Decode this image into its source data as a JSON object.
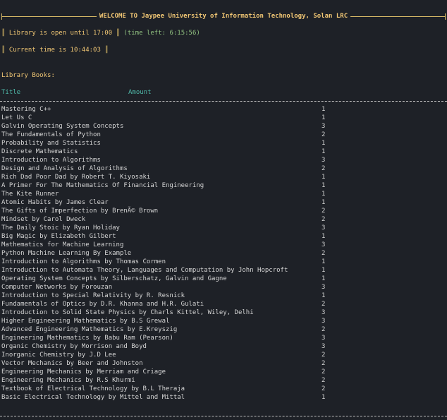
{
  "banner": {
    "title": "WELCOME TO Jaypee University of Information Technology, Solan LRC"
  },
  "status": {
    "open_text": "Library is open until 17:00",
    "time_left": "(time left: 6:15:56)",
    "current_time": "Current time is 10:44:03"
  },
  "books": {
    "section_label": "Library Books:",
    "columns": {
      "title": "Title",
      "amount": "Amount"
    },
    "rows": [
      {
        "title": "Mastering C++",
        "amount": "1"
      },
      {
        "title": "Let Us C",
        "amount": "1"
      },
      {
        "title": "Galvin Operating System Concepts",
        "amount": "3"
      },
      {
        "title": "The Fundamentals of Python",
        "amount": "2"
      },
      {
        "title": "Probability and Statistics",
        "amount": "1"
      },
      {
        "title": "Discrete Mathematics",
        "amount": "1"
      },
      {
        "title": "Introduction to Algorithms",
        "amount": "3"
      },
      {
        "title": "Design and Analysis of Algorithms",
        "amount": "2"
      },
      {
        "title": "Rich Dad Poor Dad by Robert T. Kiyosaki",
        "amount": "1"
      },
      {
        "title": "A Primer For The Mathematics Of Financial Engineering",
        "amount": "1"
      },
      {
        "title": "The Kite Runner",
        "amount": "1"
      },
      {
        "title": "Atomic Habits by James Clear",
        "amount": "1"
      },
      {
        "title": "The Gifts of Imperfection by BrenÃ© Brown",
        "amount": "2"
      },
      {
        "title": "Mindset by Carol Dweck",
        "amount": "2"
      },
      {
        "title": "The Daily Stoic by Ryan Holiday",
        "amount": "3"
      },
      {
        "title": "Big Magic by Elizabeth Gilbert",
        "amount": "1"
      },
      {
        "title": "Mathematics for Machine Learning",
        "amount": "3"
      },
      {
        "title": "Python Machine Learning By Example",
        "amount": "2"
      },
      {
        "title": "Introduction to Algorithms by Thomas Cormen",
        "amount": "1"
      },
      {
        "title": "Introduction to Automata Theory, Languages and Computation by John Hopcroft",
        "amount": "1"
      },
      {
        "title": "Operating System Concepts by Silberschatz, Galvin and Gagne",
        "amount": "1"
      },
      {
        "title": "Computer Networks by Forouzan",
        "amount": "3"
      },
      {
        "title": "Introduction to Special Relativity by R. Resnick",
        "amount": "1"
      },
      {
        "title": "Fundamentals of Optics by D.R. Khanna and H.R. Gulati",
        "amount": "2"
      },
      {
        "title": "Introduction to Solid State Physics by Charls Kittel, Wiley, Delhi",
        "amount": "3"
      },
      {
        "title": "Higher Engineering Mathematics by B.S Grewal",
        "amount": "3"
      },
      {
        "title": "Advanced Engineering Mathematics by E.Kreyszig",
        "amount": "2"
      },
      {
        "title": "Engineering Mathematics by Babu Ram (Pearson)",
        "amount": "3"
      },
      {
        "title": "Organic Chemistry by Morrison and Boyd",
        "amount": "3"
      },
      {
        "title": "Inorganic Chemistry by J.D Lee",
        "amount": "2"
      },
      {
        "title": "Vector Mechanics by Beer and Johnston",
        "amount": "2"
      },
      {
        "title": "Engineering Mechanics by Merriam and Criage",
        "amount": "2"
      },
      {
        "title": "Engineering Mechanics by R.S Khurmi",
        "amount": "2"
      },
      {
        "title": "Textbook of Electrical Technology by B.L Theraja",
        "amount": "2"
      },
      {
        "title": "Basic Electrical Technology by Mittel and Mittal",
        "amount": "1"
      }
    ]
  },
  "colors": {
    "background": "#1e2127",
    "heading_yellow": "#f0c674",
    "header_teal": "#4fb8a8",
    "time_left_green": "#8fbf7f",
    "text": "#d4d4d4"
  }
}
